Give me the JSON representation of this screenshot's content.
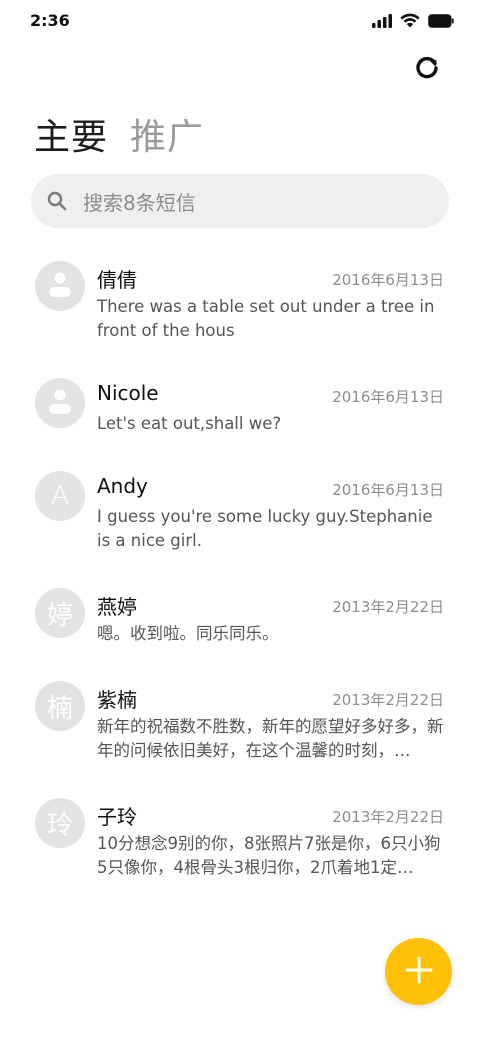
{
  "status_bar": {
    "time": "2:36",
    "icons": [
      "signal-icon",
      "wifi-icon",
      "battery-icon"
    ]
  },
  "header": {
    "refresh_icon": "refresh-icon",
    "tabs": [
      {
        "label": "主要",
        "active": true
      },
      {
        "label": "推广",
        "active": false
      }
    ]
  },
  "search": {
    "icon": "search-icon",
    "placeholder": "搜索8条短信"
  },
  "messages": [
    {
      "name": "倩倩",
      "date": "2016年6月13日",
      "preview": "There was a table set out under a tree in front of the hous",
      "avatar": {
        "type": "person-icon",
        "letter": ""
      }
    },
    {
      "name": "Nicole",
      "date": "2016年6月13日",
      "preview": "Let's eat out,shall we?",
      "avatar": {
        "type": "person-icon",
        "letter": ""
      }
    },
    {
      "name": "Andy",
      "date": "2016年6月13日",
      "preview": "I guess you're some lucky guy.Stephanie is a nice girl.",
      "avatar": {
        "type": "letter",
        "letter": "A"
      }
    },
    {
      "name": "燕婷",
      "date": "2013年2月22日",
      "preview": "嗯。收到啦。同乐同乐。",
      "avatar": {
        "type": "letter",
        "letter": "婷"
      }
    },
    {
      "name": "紫楠",
      "date": "2013年2月22日",
      "preview": "新年的祝福数不胜数，新年的愿望好多好多，新年的问候依旧美好，在这个温馨的时刻，…",
      "avatar": {
        "type": "letter",
        "letter": "楠"
      }
    },
    {
      "name": "子玲",
      "date": "2013年2月22日",
      "preview": "10分想念9别的你，8张照片7张是你，6只小狗5只像你，4根骨头3根归你，2爪着地1定…",
      "avatar": {
        "type": "letter",
        "letter": "玲"
      }
    }
  ],
  "fab": {
    "icon": "plus-icon"
  },
  "colors": {
    "accent": "#ffc107",
    "avatar_bg": "#e3e3e3",
    "search_bg": "#efefef",
    "inactive_tab": "#9b9b9b"
  }
}
